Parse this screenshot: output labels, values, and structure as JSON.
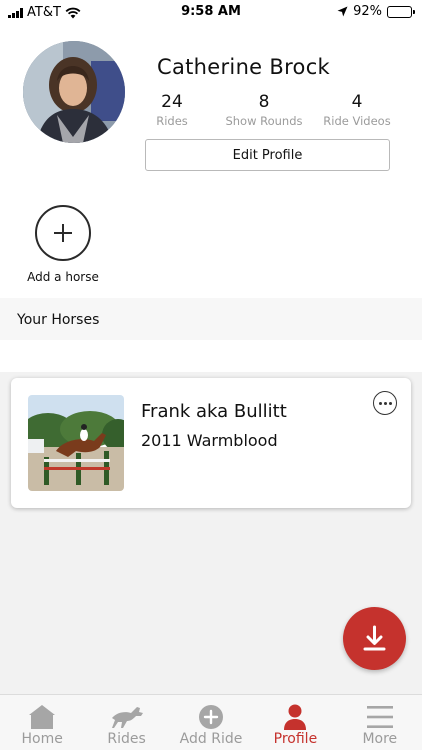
{
  "status_bar": {
    "carrier": "AT&T",
    "time": "9:58 AM",
    "battery": "92%",
    "battery_level": 0.92
  },
  "profile": {
    "name": "Catherine Brock",
    "stats": [
      {
        "value": "24",
        "label": "Rides"
      },
      {
        "value": "8",
        "label": "Show Rounds"
      },
      {
        "value": "4",
        "label": "Ride Videos"
      }
    ],
    "edit_label": "Edit Profile"
  },
  "add_horse": {
    "label": "Add a horse"
  },
  "section": {
    "title": "Your Horses"
  },
  "horses": [
    {
      "name": "Frank aka Bullitt",
      "info": "2011 Warmblood"
    }
  ],
  "tabs": [
    {
      "label": "Home",
      "icon": "home-icon"
    },
    {
      "label": "Rides",
      "icon": "horse-icon"
    },
    {
      "label": "Add Ride",
      "icon": "plus-circle-icon"
    },
    {
      "label": "Profile",
      "icon": "person-icon",
      "active": true
    },
    {
      "label": "More",
      "icon": "menu-icon"
    }
  ],
  "colors": {
    "accent": "#c5322d",
    "inactive": "#9b9b9b"
  }
}
